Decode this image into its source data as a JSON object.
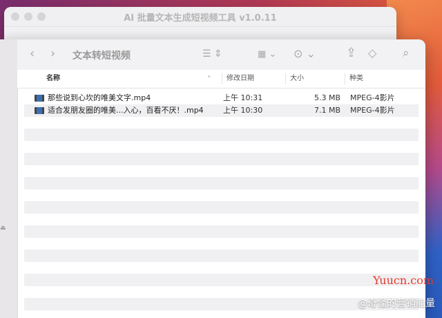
{
  "back_window": {
    "title": "AI 批量文本生成短视频工具 v1.0.11"
  },
  "finder": {
    "folder_title": "文本转短视频",
    "toolbar_icons": [
      "chevron-left-icon",
      "chevron-right-icon",
      "list-view-icon",
      "grid-view-icon",
      "more-icon",
      "share-icon",
      "tag-icon",
      "search-icon"
    ],
    "columns": {
      "name": "名称",
      "date": "修改日期",
      "size": "大小",
      "kind": "种类"
    },
    "files": [
      {
        "name": "那些说到心坎的唯美文字.mp4",
        "date": "上午 10:31",
        "size": "5.3 MB",
        "kind": "MPEG-4影片"
      },
      {
        "name": "适合发朋友圈的唯美...入心，百看不厌！.mp4",
        "date": "上午 10:30",
        "size": "7.1 MB",
        "kind": "MPEG-4影片"
      }
    ]
  },
  "watermark": "Yuucn.com",
  "source_tag": "@奇怪的营销能量"
}
